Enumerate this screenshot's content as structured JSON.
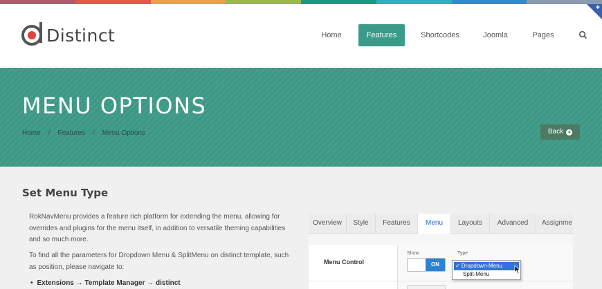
{
  "header": {
    "logo_text": "Distinct",
    "nav": [
      {
        "label": "Home",
        "active": false
      },
      {
        "label": "Features",
        "active": true
      },
      {
        "label": "Shortcodes",
        "active": false
      },
      {
        "label": "Joomla",
        "active": false
      },
      {
        "label": "Pages",
        "active": false
      }
    ],
    "search_icon": "search-icon",
    "corner_icon": "plus-icon"
  },
  "color_strip": [
    "#b05a6b",
    "#e35a4a",
    "#f0a04a",
    "#9bb84a",
    "#1a9a82",
    "#2fb0c0",
    "#2f8ad0",
    "#8a9ab0"
  ],
  "colors": {
    "accent": "#3a9b89",
    "hero_bg": "#3d9a87",
    "back_button": "#4d7a64",
    "tab_active": "#2a6fb8",
    "toggle_on": "#2b82d0",
    "selection": "#3572d8"
  },
  "hero": {
    "title": "MENU OPTIONS",
    "breadcrumb": [
      "Home",
      "Features",
      "Menu Options"
    ],
    "breadcrumb_sep": "/",
    "back_label": "Back"
  },
  "content": {
    "section_title": "Set Menu Type",
    "p1": "RokNavMenu provides a feature rich platform for extending the menu, allowing for overrides and plugins for the menu itself, in addition to versatile theming capabilities and so much more.",
    "p2": "To find all the parameters for Dropdown Menu & SplitMenu on distinct template, such as position, please navigate to:",
    "bullet": "Extensions → Template Manager → distinct"
  },
  "admin_panel": {
    "tabs": [
      "Overview",
      "Style",
      "Features",
      "Menu",
      "Layouts",
      "Advanced",
      "Assignme"
    ],
    "active_tab": "Menu",
    "row_label": "Menu Control",
    "show_label": "Show",
    "type_label": "Type",
    "toggle_label": "ON",
    "options": [
      "✓ Dropdown-Menu",
      "Split-Menu"
    ],
    "selected_option": "Dropdown-Menu"
  }
}
